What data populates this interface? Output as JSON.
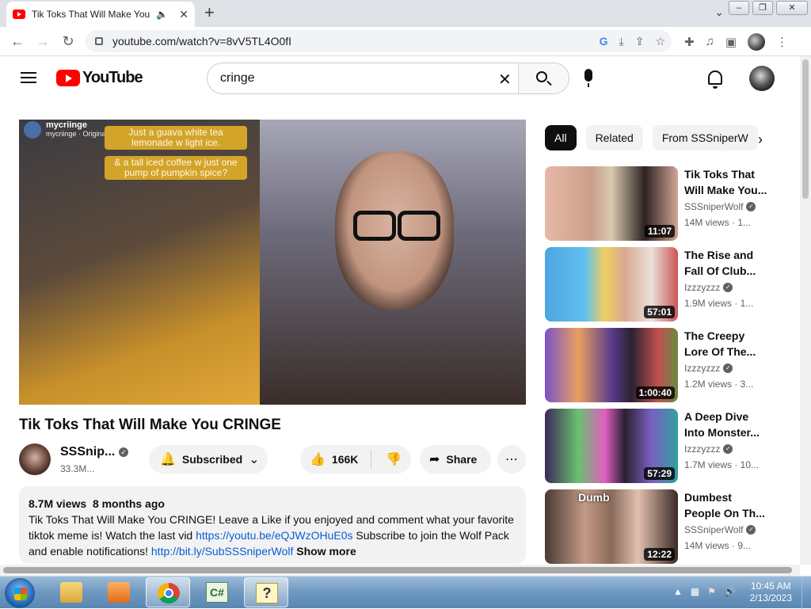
{
  "browser": {
    "tab_title": "Tik Toks That Will Make You",
    "url": "youtube.com/watch?v=8vV5TL4O0fI"
  },
  "youtube": {
    "logo_text": "YouTube",
    "search_value": "cringe"
  },
  "video": {
    "overlay_user": "mycriinge",
    "overlay_sub": "mycriinge · Original Audio",
    "caption1": "Just a guava white tea lemonade w light ice.",
    "caption2": "& a tall iced coffee w just one pump of pumpkin spice?",
    "title": "Tik Toks That Will Make You CRINGE",
    "channel_name": "SSSnip...",
    "subscribers": "33.3M...",
    "subscribed_label": "Subscribed",
    "likes": "166K",
    "share_label": "Share"
  },
  "description": {
    "views": "8.7M views",
    "age": "8 months ago",
    "text1": "Tik Toks That Will Make You CRINGE! Leave a Like if you enjoyed and comment what your favorite tiktok meme is! Watch the last vid ",
    "link1": "https://youtu.be/eQJWzOHuE0s",
    "text2": " Subscribe to join the Wolf Pack and enable notifications! ",
    "link2": "http://bit.ly/SubSSSniperWolf",
    "show_more": "Show more"
  },
  "sidebar": {
    "chips": [
      "All",
      "Related",
      "From SSSniperW"
    ],
    "recommendations": [
      {
        "title": "Tik Toks That Will Make You...",
        "channel": "SSSniperWolf",
        "meta": "14M views · 1...",
        "duration": "11:07"
      },
      {
        "title": "The Rise and Fall Of Club...",
        "channel": "Izzzyzzz",
        "meta": "1.9M views · 1...",
        "duration": "57:01"
      },
      {
        "title": "The Creepy Lore Of The...",
        "channel": "Izzzyzzz",
        "meta": "1.2M views · 3...",
        "duration": "1:00:40"
      },
      {
        "title": "A Deep Dive Into Monster...",
        "channel": "Izzzyzzz",
        "meta": "1.7M views · 10...",
        "duration": "57:29"
      },
      {
        "title": "Dumbest People On Th...",
        "channel": "SSSniperWolf",
        "meta": "14M views · 9...",
        "duration": "12:22",
        "thumb_label": "Dumb"
      }
    ]
  },
  "taskbar": {
    "time": "10:45 AM",
    "date": "2/13/2023"
  },
  "colors": {
    "youtube_red": "#ff0000",
    "link_blue": "#065fd4"
  }
}
